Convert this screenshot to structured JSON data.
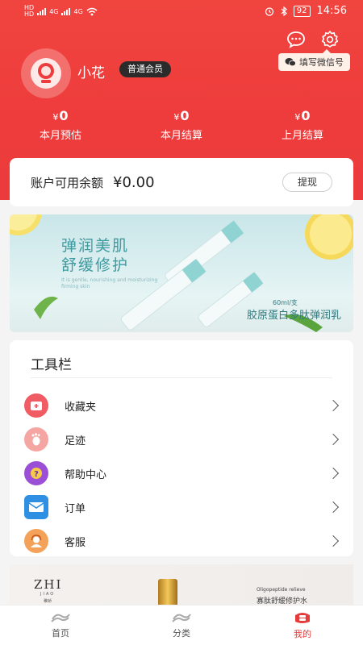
{
  "status_bar": {
    "left_labels": [
      "HD",
      "HD"
    ],
    "signal_labels": [
      "4G",
      "4G"
    ],
    "battery": "92",
    "time": "14:56"
  },
  "header": {
    "wechat_tag": "填写微信号"
  },
  "profile": {
    "username": "小花",
    "member_badge": "普通会员"
  },
  "stats": [
    {
      "currency": "¥",
      "value": "0",
      "label": "本月预估"
    },
    {
      "currency": "¥",
      "value": "0",
      "label": "本月结算"
    },
    {
      "currency": "¥",
      "value": "0",
      "label": "上月结算"
    }
  ],
  "balance": {
    "label": "账户可用余额",
    "amount": "¥0.00",
    "withdraw_label": "提现"
  },
  "banner": {
    "title_line1": "弹润美肌",
    "title_line2": "舒缓修护",
    "english_text": "It is gentle, nourishing and moisturizing firming skin",
    "spec": "60ml/支",
    "product_name": "胶原蛋白多肽弹润乳"
  },
  "tools": {
    "title": "工具栏",
    "items": [
      {
        "label": "收藏夹",
        "icon": "favorites-icon"
      },
      {
        "label": "足迹",
        "icon": "footprint-icon"
      },
      {
        "label": "帮助中心",
        "icon": "help-icon"
      },
      {
        "label": "订单",
        "icon": "orders-icon"
      },
      {
        "label": "客服",
        "icon": "customer-service-icon"
      }
    ]
  },
  "promo": {
    "brand_en": "ZHI",
    "brand_sub": "JIAO",
    "brand_cn": "稚娇",
    "tagline_en": "Oligopeptide relieve",
    "tagline_cn": "寡肽舒缓修护水"
  },
  "bottom_nav": {
    "items": [
      {
        "label": "首页",
        "active": false
      },
      {
        "label": "分类",
        "active": false
      },
      {
        "label": "我的",
        "active": true
      }
    ]
  },
  "colors": {
    "primary_red": "#ee3c3c",
    "active_nav": "#e63b3b"
  }
}
